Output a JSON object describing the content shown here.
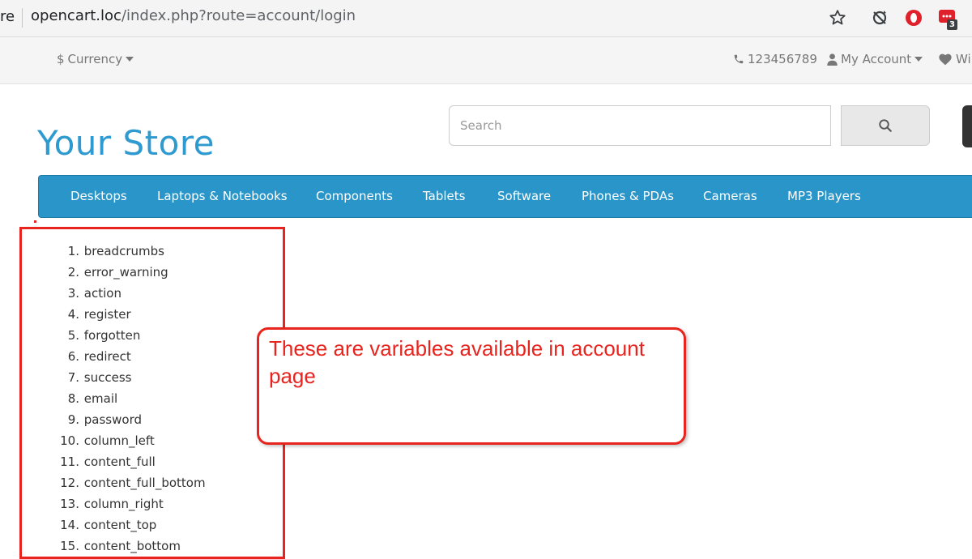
{
  "browser": {
    "tab_stub": "re",
    "url_host": "opencart.loc",
    "url_path": "/index.php?route=account/login",
    "extension_badge": "3"
  },
  "top_bar": {
    "currency_label": "Currency",
    "currency_symbol": "$",
    "phone": "123456789",
    "my_account_label": "My Account",
    "wishlist_label": "Wi"
  },
  "header": {
    "logo_text": "Your Store",
    "search_placeholder": "Search"
  },
  "menu": {
    "items": [
      "Desktops",
      "Laptops & Notebooks",
      "Components",
      "Tablets",
      "Software",
      "Phones & PDAs",
      "Cameras",
      "MP3 Players"
    ]
  },
  "variables": [
    {
      "num": "1.",
      "name": "breadcrumbs"
    },
    {
      "num": "2.",
      "name": "error_warning"
    },
    {
      "num": "3.",
      "name": "action"
    },
    {
      "num": "4.",
      "name": "register"
    },
    {
      "num": "5.",
      "name": "forgotten"
    },
    {
      "num": "6.",
      "name": "redirect"
    },
    {
      "num": "7.",
      "name": "success"
    },
    {
      "num": "8.",
      "name": "email"
    },
    {
      "num": "9.",
      "name": "password"
    },
    {
      "num": "10.",
      "name": "column_left"
    },
    {
      "num": "11.",
      "name": "content_full"
    },
    {
      "num": "12.",
      "name": "content_full_bottom"
    },
    {
      "num": "13.",
      "name": "column_right"
    },
    {
      "num": "14.",
      "name": "content_top"
    },
    {
      "num": "15.",
      "name": "content_bottom"
    }
  ],
  "annotation": {
    "text": "These are variables available in account page"
  },
  "colors": {
    "brand_blue": "#2a95c9",
    "logo_blue": "#2e9ad0",
    "annotation_red": "#e8241f"
  }
}
